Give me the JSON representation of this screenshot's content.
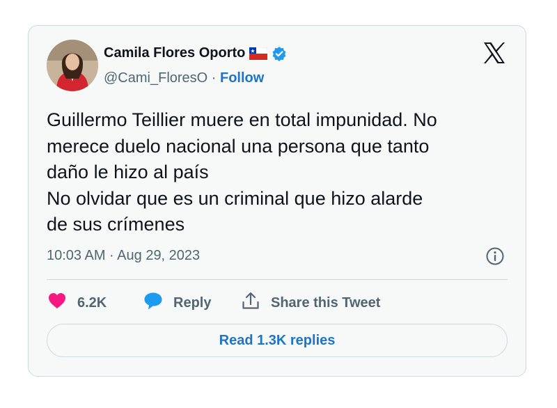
{
  "author": {
    "name": "Camila Flores Oporto",
    "handle": "@Cami_FloresO",
    "separator": " · ",
    "follow_label": "Follow",
    "flag_icon": "chile-flag-icon",
    "verified_icon": "verified-badge-icon"
  },
  "tweet": {
    "text": "Guillermo Teillier muere en total impunidad. No\nmerece duelo nacional una persona que tanto\ndaño le hizo al país\nNo olvidar que es un criminal que hizo alarde\nde sus crímenes",
    "timestamp": "10:03 AM · Aug 29, 2023"
  },
  "actions": {
    "likes_count": "6.2K",
    "reply_label": "Reply",
    "share_label": "Share this Tweet"
  },
  "replies_button": {
    "label": "Read 1.3K replies"
  },
  "colors": {
    "accent": "#1d74c8",
    "like": "#f91880",
    "text": "#0f1419",
    "secondary": "#536471",
    "card_bg": "#f7f9f9",
    "border": "#cfd9de"
  }
}
